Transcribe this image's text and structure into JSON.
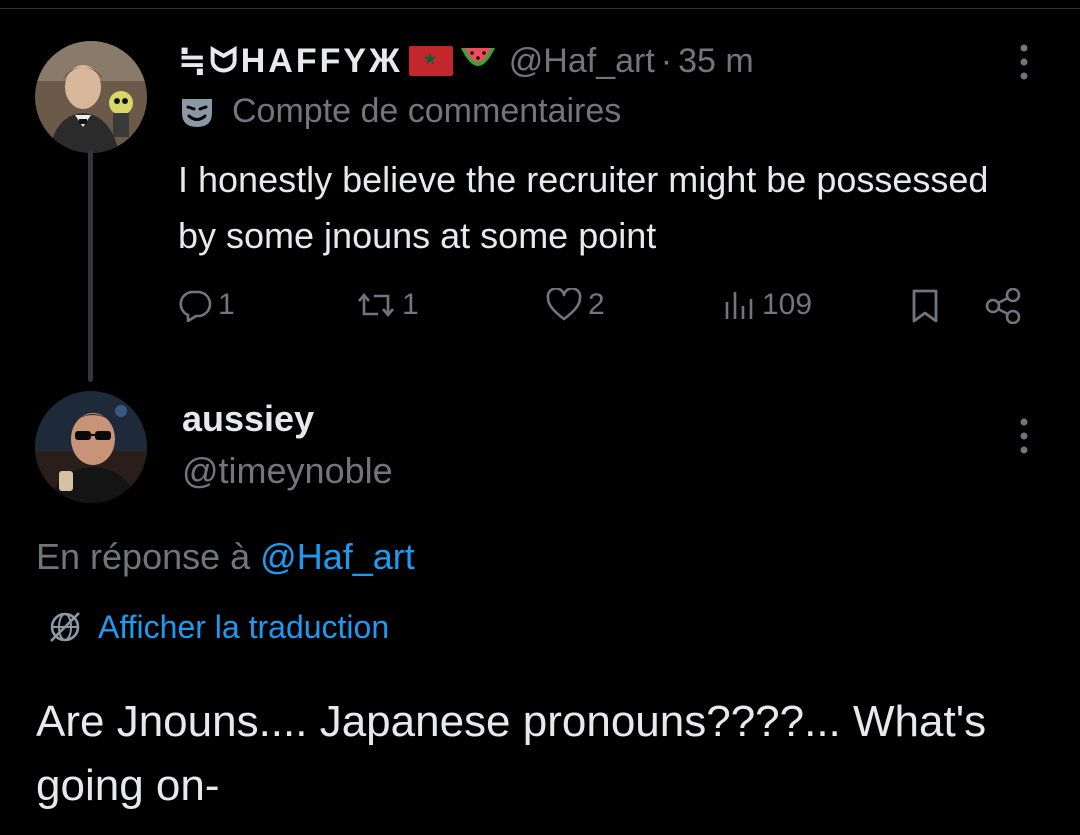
{
  "colors": {
    "background": "#000000",
    "text_primary": "#e7e9ea",
    "text_secondary": "#71767b",
    "link": "#1d9bf0",
    "divider": "#2f3336"
  },
  "parent_post": {
    "avatar_icon": "user-avatar",
    "display_name": "≒ᗢHAFFYЖ",
    "display_name_emojis": [
      "flag-morocco",
      "watermelon"
    ],
    "handle": "@Haf_art",
    "separator": "·",
    "time": "35 m",
    "more_icon": "more-vertical-icon",
    "community_icon": "theater-masks-icon",
    "community_label": "Compte de commentaires",
    "text": "I honestly believe the recruiter might be possessed by some jnouns at some point",
    "actions": {
      "reply": {
        "icon": "reply-icon",
        "count": "1"
      },
      "repost": {
        "icon": "repost-icon",
        "count": "1"
      },
      "like": {
        "icon": "heart-icon",
        "count": "2"
      },
      "views": {
        "icon": "views-icon",
        "count": "109"
      },
      "bookmark": {
        "icon": "bookmark-icon"
      },
      "share": {
        "icon": "share-icon"
      }
    }
  },
  "reply_post": {
    "avatar_icon": "user-avatar",
    "display_name": "aussiey",
    "handle": "@timeynoble",
    "more_icon": "more-vertical-icon",
    "reply_prefix": "En réponse à ",
    "reply_handle": "@Haf_art",
    "translate_icon": "globe-icon",
    "translate_label": "Afficher la traduction",
    "text": "Are Jnouns.... Japanese pronouns????... What's going on-"
  }
}
